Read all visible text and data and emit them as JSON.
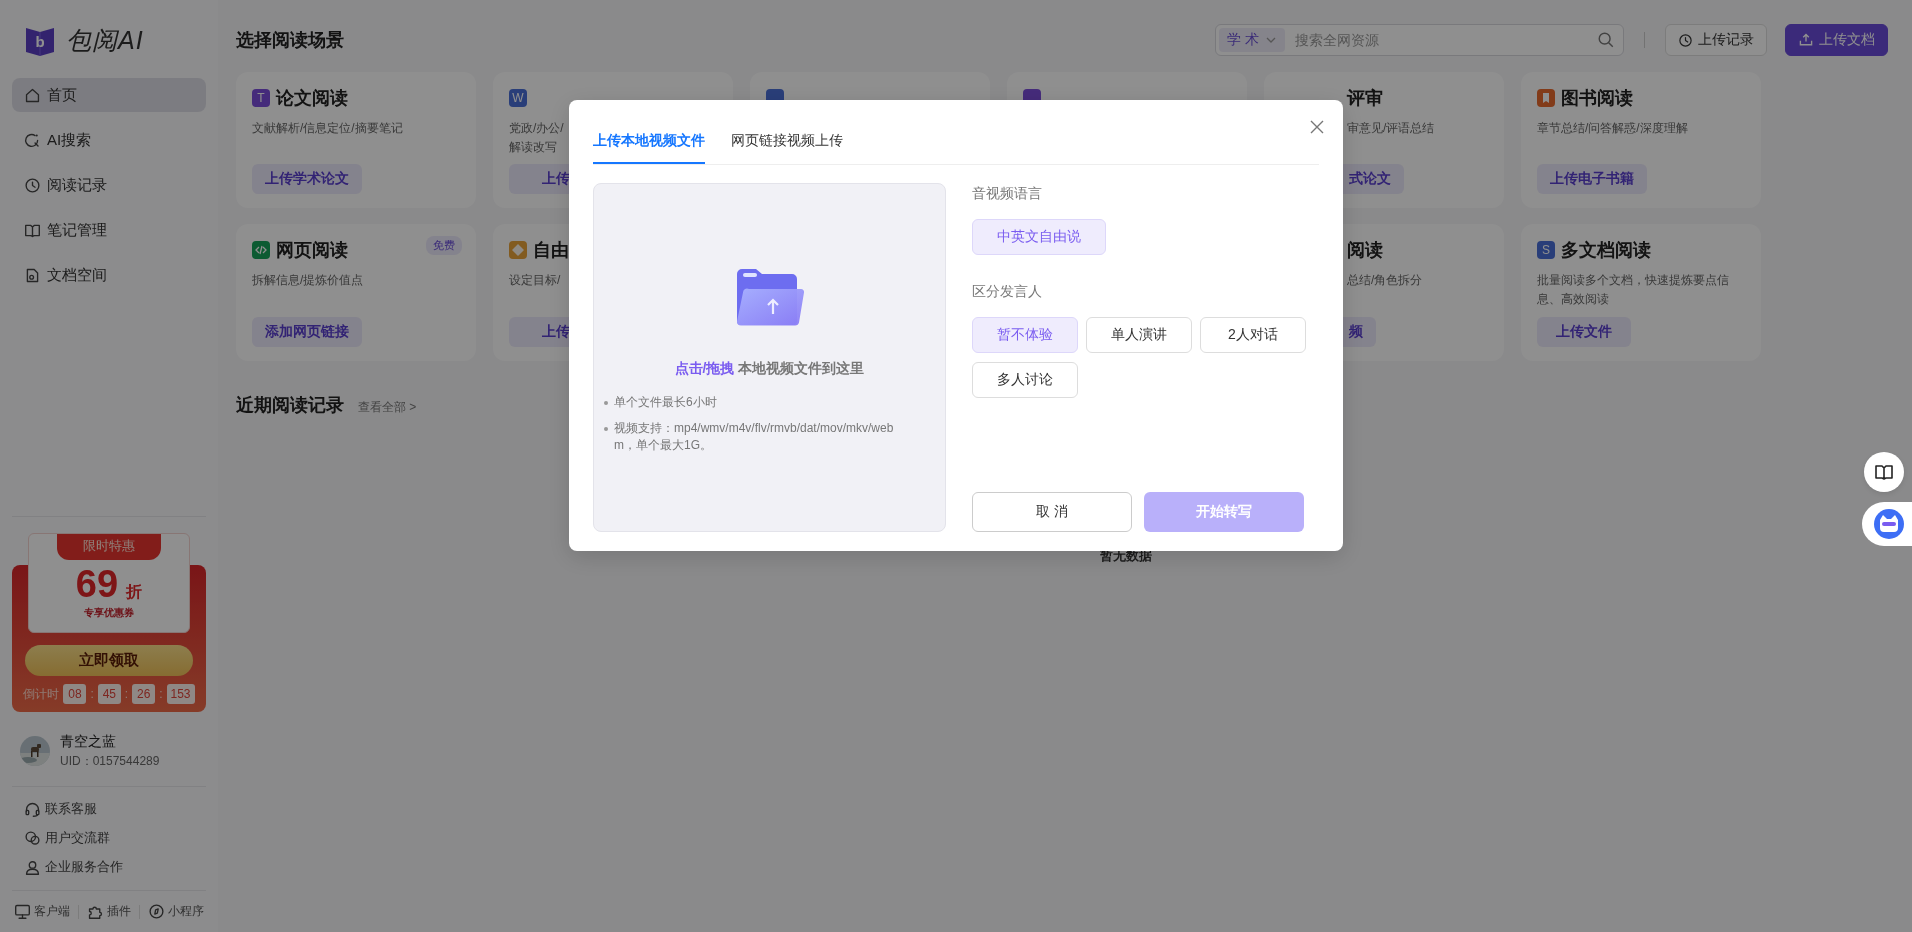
{
  "sidebar": {
    "logo_mark": "b",
    "logo_text": "包阅AI",
    "nav": [
      {
        "label": "首页",
        "selected": true
      },
      {
        "label": "AI搜索",
        "selected": false
      },
      {
        "label": "阅读记录",
        "selected": false
      },
      {
        "label": "笔记管理",
        "selected": false
      },
      {
        "label": "文档空间",
        "selected": false
      }
    ],
    "promo": {
      "ribbon": "限时特惠",
      "discount": "69",
      "unit": "折",
      "subtitle": "专享优惠券",
      "button": "立即领取",
      "countdown_label": "倒计时",
      "countdown": [
        "08",
        "45",
        "26",
        "153"
      ],
      "separators": [
        ":",
        ":",
        ":"
      ]
    },
    "user": {
      "name": "青空之蓝",
      "uid": "UID：0157544289"
    },
    "links": [
      "联系客服",
      "用户交流群",
      "企业服务合作"
    ],
    "footer": [
      "客户端",
      "插件",
      "小程序"
    ]
  },
  "header": {
    "title": "选择阅读场景",
    "search": {
      "scope": "学 术",
      "placeholder": "搜索全网资源"
    },
    "buttons": [
      {
        "label": "上传记录",
        "kind": "outline"
      },
      {
        "label": "上传文档",
        "kind": "primary"
      }
    ]
  },
  "card_rows": [
    [
      {
        "kind": "paper",
        "letter": "T",
        "title": "论文阅读",
        "desc": [
          "文献解析/信息定位/摘要笔记"
        ],
        "button": "上传学术论文"
      },
      {
        "kind": "document",
        "letter": "W",
        "desc": [
          "党政/办公/",
          "解读改写"
        ],
        "button": "上传"
      },
      {
        "kind": "document"
      },
      {
        "kind": "paper"
      },
      {
        "title": "评审",
        "desc": [
          "审意见/评语总结"
        ],
        "button": "式论文",
        "covered_left": true
      },
      {
        "kind": "book",
        "title": "图书阅读",
        "desc": [
          "章节总结/问答解惑/深度理解"
        ],
        "button": "上传电子书籍"
      }
    ],
    [
      {
        "kind": "web",
        "title": "网页阅读",
        "badge": "免费",
        "desc": [
          "拆解信息/提炼价值点"
        ],
        "button": "添加网页链接"
      },
      {
        "kind": "goal",
        "title": "自由",
        "desc": [
          "设定目标/"
        ],
        "button": "上传"
      },
      {},
      {},
      {
        "title": "阅读",
        "desc": [
          "总结/角色拆分"
        ],
        "button": "频",
        "covered_left": true
      },
      {
        "kind": "multi",
        "letter": "S",
        "title": "多文档阅读",
        "desc": [
          "批量阅读多个文档，快速提炼要点信息、高效阅读"
        ],
        "button": "上传文件"
      }
    ]
  ],
  "recent": {
    "title": "近期阅读记录",
    "link": "查看全部 >",
    "empty": "暂无数据"
  },
  "modal": {
    "tabs": [
      {
        "label": "上传本地视频文件",
        "selected": true
      },
      {
        "label": "网页链接视频上传",
        "selected": false
      }
    ],
    "drop_text": "**点击/拖拽** 本地视频文件到这里",
    "notes": [
      "单个文件最长6小时",
      "视频支持：mp4/wmv/m4v/flv/rmvb/dat/mov/mkv/webm，单个最大1G。"
    ],
    "groups": [
      {
        "label": "音视频语言",
        "options": [
          {
            "label": "中英文自由说",
            "selected": true
          }
        ]
      },
      {
        "label": "区分发言人",
        "options": [
          {
            "label": "暂不体验",
            "selected": true
          },
          {
            "label": "单人演讲",
            "selected": false
          },
          {
            "label": "2人对话",
            "selected": false
          },
          {
            "label": "多人讨论",
            "selected": false
          }
        ]
      }
    ],
    "cancel": "取 消",
    "confirm": {
      "label": "开始转写",
      "disabled": true
    }
  },
  "float_buttons": [
    {
      "kind": "book"
    },
    {
      "kind": "robot"
    }
  ]
}
